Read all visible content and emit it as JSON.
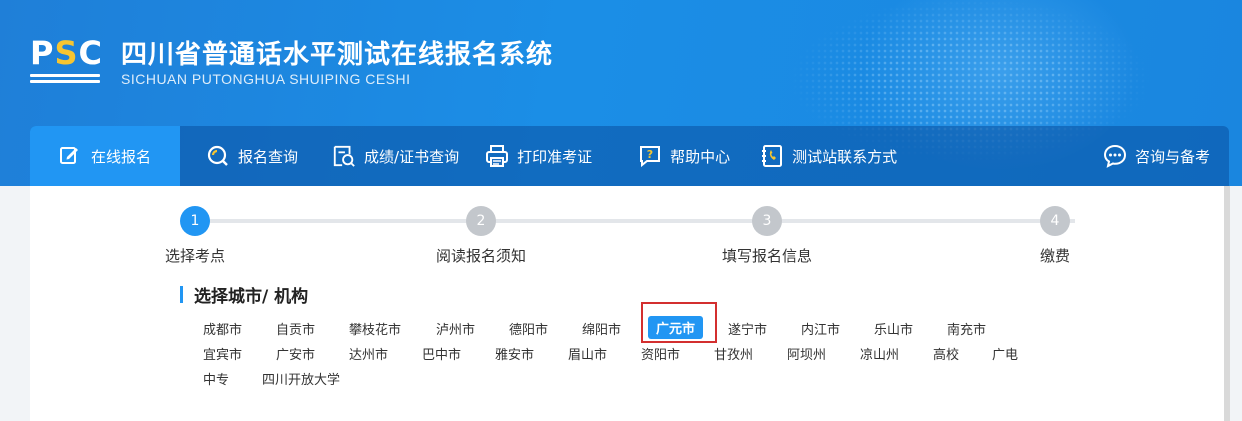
{
  "header": {
    "logo": "PSC",
    "title": "四川省普通话水平测试在线报名系统",
    "subtitle": "SICHUAN PUTONGHUA SHUIPING CESHI"
  },
  "nav": {
    "items": [
      {
        "label": "在线报名",
        "icon": "edit-icon"
      },
      {
        "label": "报名查询",
        "icon": "search-icon"
      },
      {
        "label": "成绩/证书查询",
        "icon": "certificate-search-icon"
      },
      {
        "label": "打印准考证",
        "icon": "printer-icon"
      },
      {
        "label": "帮助中心",
        "icon": "help-icon"
      },
      {
        "label": "测试站联系方式",
        "icon": "phone-book-icon"
      },
      {
        "label": "咨询与备考",
        "icon": "chat-icon"
      }
    ]
  },
  "steps": [
    {
      "num": "1",
      "label": "选择考点"
    },
    {
      "num": "2",
      "label": "阅读报名须知"
    },
    {
      "num": "3",
      "label": "填写报名信息"
    },
    {
      "num": "4",
      "label": "缴费"
    }
  ],
  "section": {
    "title": "选择城市/ 机构"
  },
  "cities": [
    "成都市",
    "自贡市",
    "攀枝花市",
    "泸州市",
    "德阳市",
    "绵阳市",
    "广元市",
    "遂宁市",
    "内江市",
    "乐山市",
    "南充市",
    "宜宾市",
    "广安市",
    "达州市",
    "巴中市",
    "雅安市",
    "眉山市",
    "资阳市",
    "甘孜州",
    "阿坝州",
    "凉山州",
    "高校",
    "广电",
    "中专",
    "四川开放大学"
  ],
  "selected_city": "广元市",
  "colors": {
    "accent": "#2196f3",
    "highlight": "#d32f2f"
  }
}
